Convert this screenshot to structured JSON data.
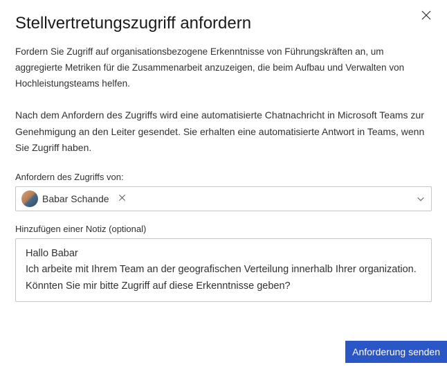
{
  "dialog": {
    "title": "Stellvertretungszugriff anfordern",
    "intro": "Fordern Sie Zugriff auf organisationsbezogene Erkenntnisse von Führungskräften an, um aggregierte Metriken für die Zusammenarbeit anzuzeigen, die beim Aufbau und Verwalten von Hochleistungsteams helfen.",
    "info": "Nach dem Anfordern des Zugriffs wird eine automatisierte Chatnachricht in Microsoft Teams zur Genehmigung an den Leiter gesendet. Sie erhalten eine automatisierte Antwort in Teams, wenn Sie Zugriff haben."
  },
  "requestFrom": {
    "label": "Anfordern des Zugriffs von:",
    "selected": {
      "name": "Babar Schande"
    }
  },
  "note": {
    "label": "Hinzufügen einer Notiz (optional)",
    "value": "Hallo Babar\nIch arbeite mit Ihrem Team an der geografischen Verteilung innerhalb Ihrer organization. Könnten Sie mir bitte Zugriff auf diese Erkenntnisse geben?"
  },
  "actions": {
    "submit": "Anforderung senden"
  },
  "colors": {
    "primary": "#2b56c5"
  }
}
